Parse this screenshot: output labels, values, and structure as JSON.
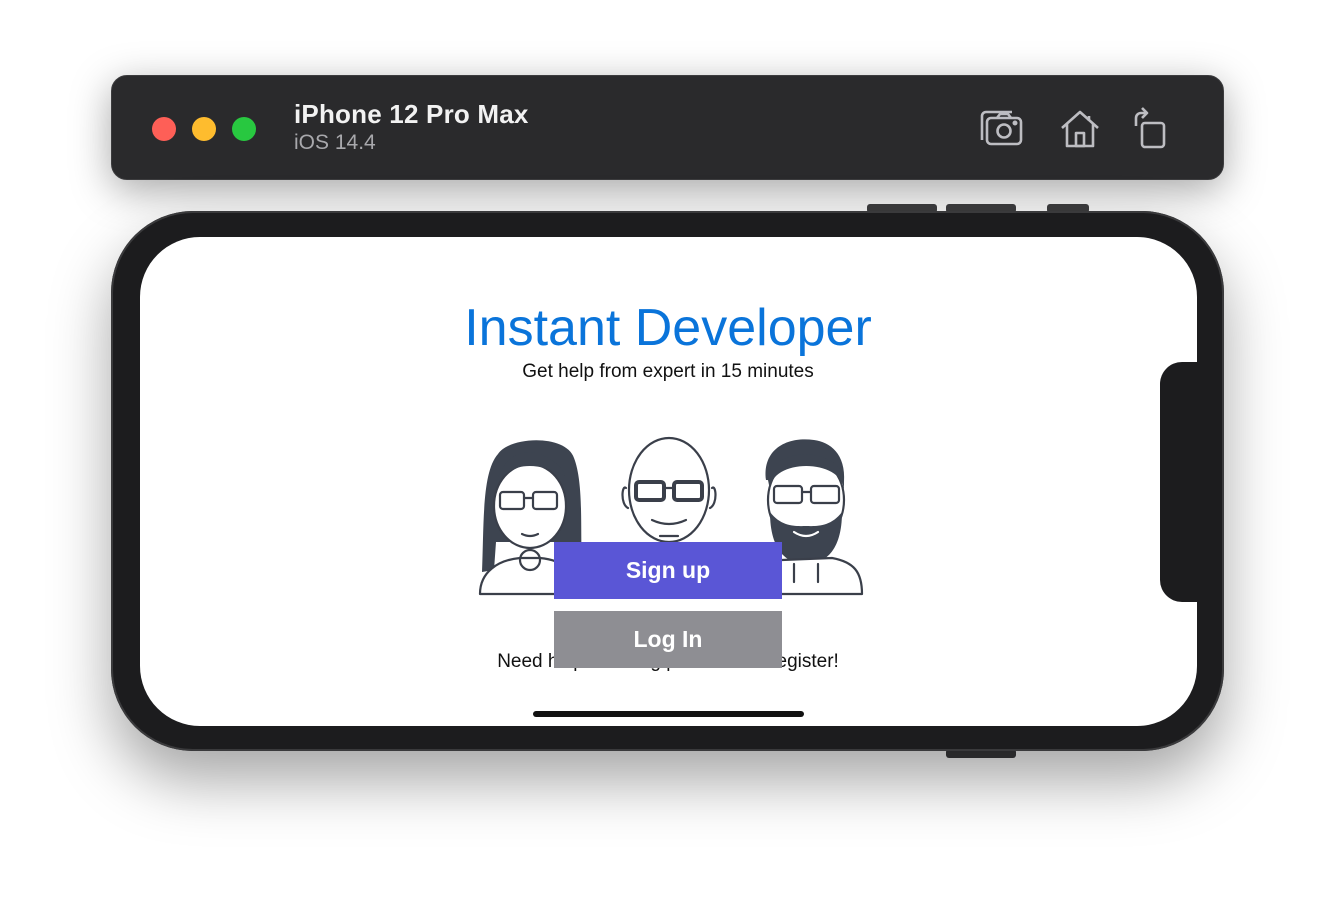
{
  "simulator": {
    "device_name": "iPhone 12 Pro Max",
    "os_version": "iOS 14.4",
    "toolbar_icons": [
      "screenshot-icon",
      "home-icon",
      "rotate-icon"
    ],
    "traffic_lights": [
      "#fe5f57",
      "#febc2e",
      "#28c840"
    ]
  },
  "app": {
    "title": "Instant Developer",
    "subtitle": "Get help from expert in 15 minutes",
    "signup_label": "Sign up",
    "login_label": "Log In",
    "register_text": "Need help? Getting paid? Let's Register!",
    "colors": {
      "title": "#0a74da",
      "signup_button": "#5a56d6",
      "login_button": "#8e8e93"
    }
  }
}
